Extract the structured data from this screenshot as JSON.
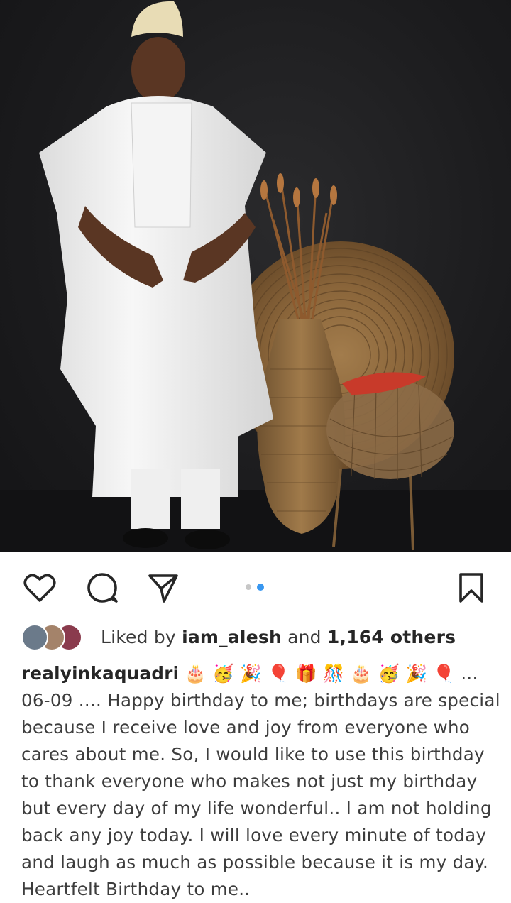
{
  "post": {
    "image_alt": "man in white agbada with woven fan, vase and basket",
    "carousel": {
      "total": 2,
      "active": 2
    }
  },
  "actions": {
    "like_icon": "heart-icon",
    "comment_icon": "comment-icon",
    "share_icon": "send-icon",
    "save_icon": "bookmark-icon"
  },
  "likes": {
    "prefix": "Liked by",
    "user": "iam_alesh",
    "middle": "and",
    "others": "1,164 others"
  },
  "caption": {
    "username": "realyinkaquadri",
    "emojis": "🎂 🥳 🎉 🎈 🎁 🎊 🎂 🥳 🎉 🎈 ...",
    "lines": [
      "06-09 .... Happy birthday to me; birthdays are special",
      "because I receive love and joy from everyone who",
      "cares about me. So, I would like to use this birthday",
      "to thank everyone who makes not just my birthday",
      "but every day of my life wonderful.. I am not holding",
      "back any joy today. I will love every minute of today",
      "and laugh as much as possible because it is my day.",
      "Heartfelt Birthday to me.."
    ]
  },
  "colors": {
    "accent_dot": "#3897f0",
    "text": "#262626"
  }
}
